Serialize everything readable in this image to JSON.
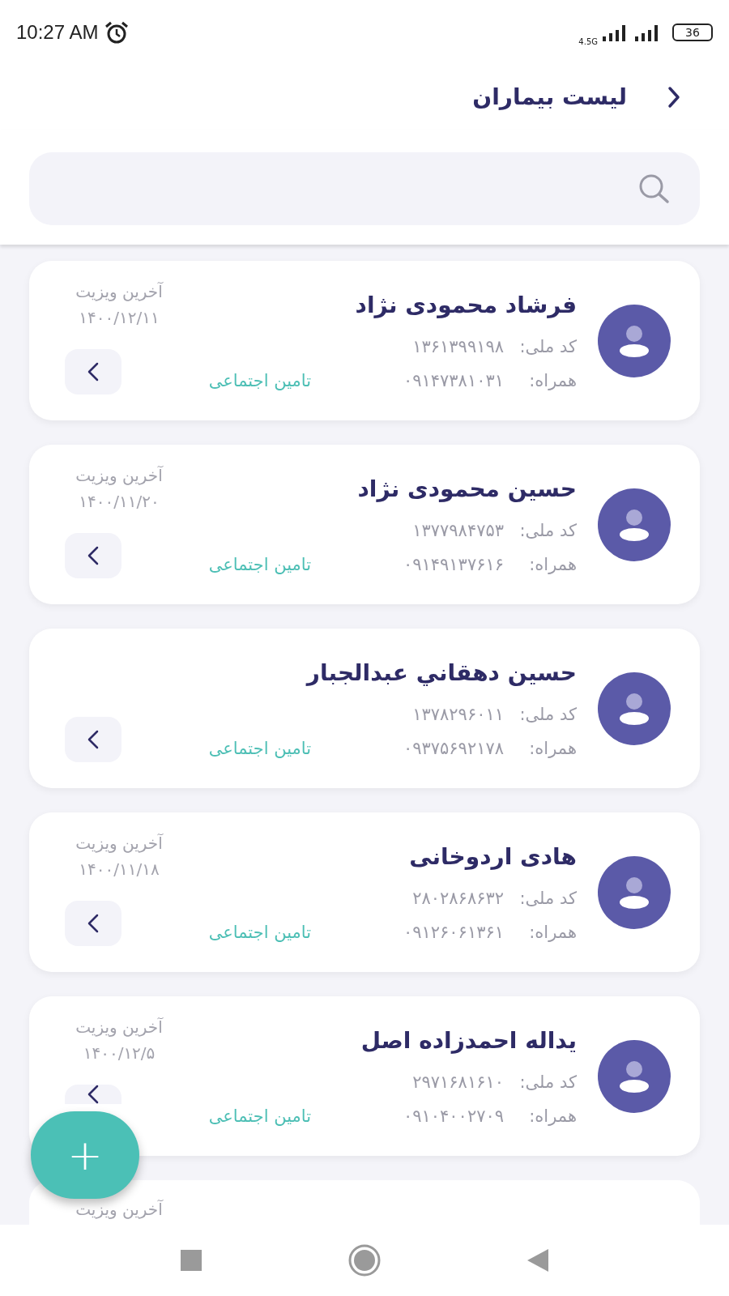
{
  "status_bar": {
    "time": "10:27 AM",
    "network": "4.5G",
    "battery": "36"
  },
  "header": {
    "title": "لیست بیماران"
  },
  "patients": [
    {
      "name": "فرشاد محمودی نژاد",
      "national_id_label": "کد ملی:",
      "national_id": "۱۳۶۱۳۹۹۱۹۸",
      "phone_label": "همراه:",
      "phone": "۰۹۱۴۷۳۸۱۰۳۱",
      "insurance": "تامین اجتماعی",
      "last_visit_label": "آخرین ویزیت",
      "last_visit": "۱۴۰۰/۱۲/۱۱"
    },
    {
      "name": "حسین محمودی نژاد",
      "national_id_label": "کد ملی:",
      "national_id": "۱۳۷۷۹۸۴۷۵۳",
      "phone_label": "همراه:",
      "phone": "۰۹۱۴۹۱۳۷۶۱۶",
      "insurance": "تامین اجتماعی",
      "last_visit_label": "آخرین ویزیت",
      "last_visit": "۱۴۰۰/۱۱/۲۰"
    },
    {
      "name": "حسين دهقاني عبدالجبار",
      "national_id_label": "کد ملی:",
      "national_id": "۱۳۷۸۲۹۶۰۱۱",
      "phone_label": "همراه:",
      "phone": "۰۹۳۷۵۶۹۲۱۷۸",
      "insurance": "تامین اجتماعی"
    },
    {
      "name": "هادی اردوخانی",
      "national_id_label": "کد ملی:",
      "national_id": "۲۸۰۲۸۶۸۶۳۲",
      "phone_label": "همراه:",
      "phone": "۰۹۱۲۶۰۶۱۳۶۱",
      "insurance": "تامین اجتماعی",
      "last_visit_label": "آخرین ویزیت",
      "last_visit": "۱۴۰۰/۱۱/۱۸"
    },
    {
      "name": "یداله احمدزاده اصل",
      "national_id_label": "کد ملی:",
      "national_id": "۲۹۷۱۶۸۱۶۱۰",
      "phone_label": "همراه:",
      "phone": "۰۹۱۰۴۰۰۲۷۰۹",
      "insurance": "تامین اجتماعی",
      "last_visit_label": "آخرین ویزیت",
      "last_visit": "۱۴۰۰/۱۲/۵"
    }
  ],
  "partial_card": {
    "last_visit_label": "آخرین ویزیت"
  },
  "fab": {
    "label": "+"
  }
}
